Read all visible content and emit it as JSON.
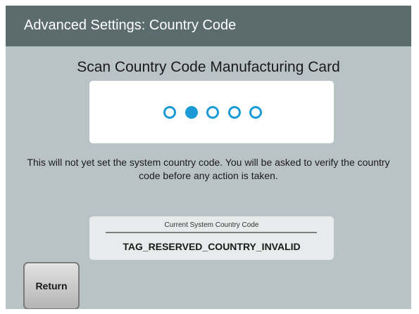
{
  "header": {
    "title": "Advanced Settings: Country Code"
  },
  "main": {
    "title": "Scan Country Code Manufacturing Card",
    "progress": {
      "total_steps": 5,
      "active_step": 2,
      "color": "#1a9ad6"
    },
    "info_text": "This will not yet set the system country code. You will be asked to verify the country code before any action is taken."
  },
  "current_code": {
    "label": "Current System Country Code",
    "value": "TAG_RESERVED_COUNTRY_INVALID"
  },
  "footer": {
    "return_label": "Return"
  },
  "colors": {
    "header_background": "#5c6b6e",
    "screen_background": "#b9c2c4",
    "accent": "#1a9ad6"
  }
}
